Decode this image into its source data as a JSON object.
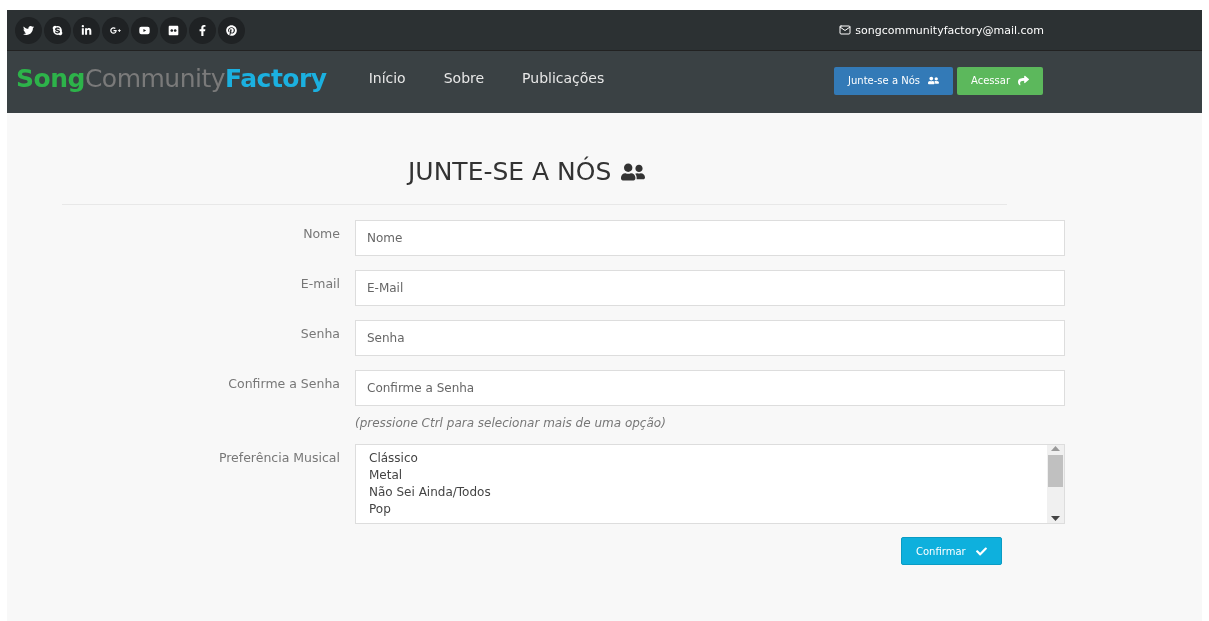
{
  "topbar": {
    "social": [
      {
        "kind": "twitter"
      },
      {
        "kind": "skype"
      },
      {
        "kind": "linkedin"
      },
      {
        "kind": "googleplus"
      },
      {
        "kind": "youtube"
      },
      {
        "kind": "flickr"
      },
      {
        "kind": "facebook"
      },
      {
        "kind": "pinterest"
      }
    ],
    "email": "songcommunityfactory@mail.com"
  },
  "navbar": {
    "logo": [
      {
        "text": "Song",
        "color": "#2db34a"
      },
      {
        "text": "Community",
        "color": "#7a7a7a"
      },
      {
        "text": "Factory",
        "color": "#1bb0e0"
      }
    ],
    "links": [
      "Início",
      "Sobre",
      "Publicações"
    ],
    "buttons": [
      {
        "kind": "join",
        "label": "Junte-se a Nós"
      },
      {
        "kind": "login",
        "label": "Acessar"
      }
    ]
  },
  "form": {
    "title": "JUNTE-SE A NÓS",
    "fields": [
      {
        "label": "Nome",
        "placeholder": "Nome"
      },
      {
        "label": "E-mail",
        "placeholder": "E-Mail"
      },
      {
        "label": "Senha",
        "placeholder": "Senha"
      },
      {
        "label": "Confirme a Senha",
        "placeholder": "Confirme a Senha"
      }
    ],
    "hint": "(pressione Ctrl para selecionar mais de uma opção)",
    "select": {
      "label": "Preferência Musical",
      "options": [
        "Clássico",
        "Metal",
        "Não Sei Ainda/Todos",
        "Pop"
      ]
    },
    "submit": "Confirmar"
  }
}
